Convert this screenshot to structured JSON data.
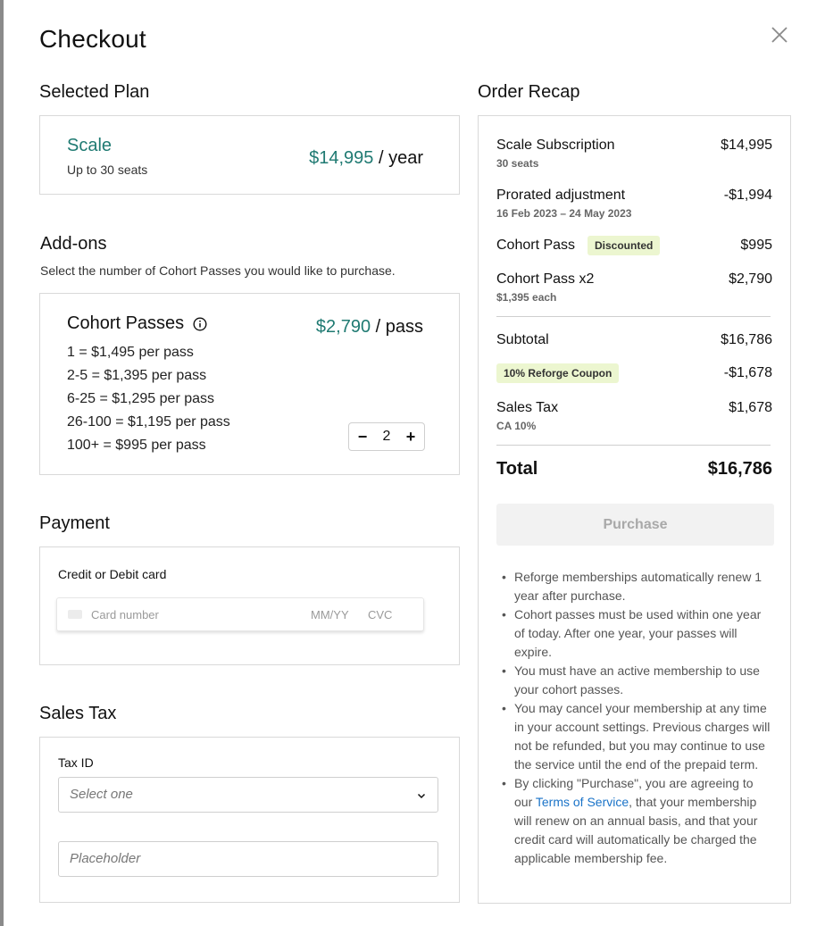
{
  "title": "Checkout",
  "close_icon": "close-icon",
  "selected_plan": {
    "heading": "Selected Plan",
    "name": "Scale",
    "seats": "Up to 30 seats",
    "price": "$14,995",
    "period": " / year"
  },
  "addons": {
    "heading": "Add-ons",
    "description": "Select the number of Cohort Passes you would like to purchase.",
    "title": "Cohort Passes",
    "price": "$2,790",
    "unit": " / pass",
    "tiers": [
      "1 = $1,495 per pass",
      "2-5 = $1,395 per pass",
      "6-25 = $1,295 per pass",
      "26-100 = $1,195 per pass",
      "100+ = $995 per pass"
    ],
    "quantity": "2",
    "minus": "−",
    "plus": "+"
  },
  "payment": {
    "heading": "Payment",
    "card_label": "Credit or Debit card",
    "card_number_placeholder": "Card number",
    "expiry_placeholder": "MM/YY",
    "cvc_placeholder": "CVC"
  },
  "sales_tax": {
    "heading": "Sales Tax",
    "tax_id_label": "Tax ID",
    "select_placeholder": "Select one",
    "input_placeholder": "Placeholder"
  },
  "recap": {
    "heading": "Order Recap",
    "items": [
      {
        "label": "Scale Subscription",
        "sub": "30 seats",
        "amount": "$14,995"
      },
      {
        "label": "Prorated adjustment",
        "sub": "16 Feb 2023 – 24 May 2023",
        "amount": "-$1,994"
      },
      {
        "label": "Cohort Pass",
        "badge": "Discounted",
        "amount": "$995"
      },
      {
        "label": "Cohort Pass x2",
        "sub": "$1,395 each",
        "amount": "$2,790"
      }
    ],
    "subtotal_label": "Subtotal",
    "subtotal": "$16,786",
    "coupon": "10% Reforge Coupon",
    "coupon_amount": "-$1,678",
    "tax_label": "Sales Tax",
    "tax_sub": "CA 10%",
    "tax_amount": "$1,678",
    "total_label": "Total",
    "total": "$16,786",
    "purchase_label": "Purchase",
    "notes": [
      "Reforge memberships automatically renew 1 year after purchase.",
      "Cohort passes must be used within one year of today. After one year, your passes will expire.",
      "You must have an active membership to use your cohort passes.",
      "You may cancel your membership at any time in your account settings. Previous charges will not be refunded, but you may continue to use the service until the end of the prepaid term."
    ],
    "last_note_before": "By clicking \"Purchase\", you are agreeing to our ",
    "terms_link": "Terms of Service",
    "last_note_after": ", that your membership will renew on an annual basis, and that your credit card will automatically be charged the applicable membership fee."
  },
  "colors": {
    "accent": "#1f7a72",
    "badge_bg": "#ecf6d0",
    "link": "#1a73c8"
  }
}
